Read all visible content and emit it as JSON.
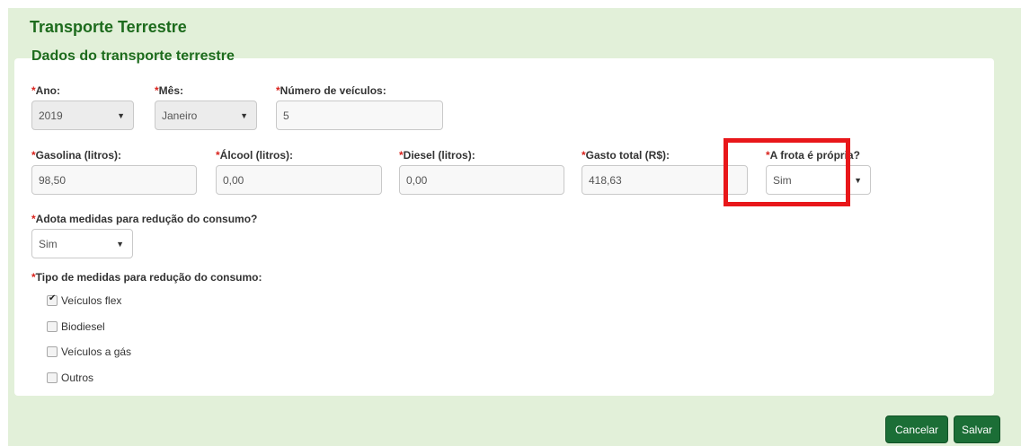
{
  "page": {
    "title": "Transporte Terrestre"
  },
  "section": {
    "title": "Dados do transporte terrestre"
  },
  "required_mark": "*",
  "fields": {
    "ano": {
      "label": "Ano:",
      "value": "2019"
    },
    "mes": {
      "label": "Mês:",
      "value": "Janeiro"
    },
    "num_veiculos": {
      "label": "Número de veículos:",
      "value": "5"
    },
    "gasolina": {
      "label": "Gasolina (litros):",
      "value": "98,50"
    },
    "alcool": {
      "label": "Álcool (litros):",
      "value": "0,00"
    },
    "diesel": {
      "label": "Diesel (litros):",
      "value": "0,00"
    },
    "gasto_total": {
      "label": "Gasto total (R$):",
      "value": "418,63"
    },
    "frota_propria": {
      "label": "A frota é própria?",
      "value": "Sim"
    },
    "adota_medidas": {
      "label": "Adota medidas para redução do consumo?",
      "value": "Sim"
    }
  },
  "tipo_medidas": {
    "label": "Tipo de medidas para redução do consumo:",
    "options": [
      {
        "label": "Veículos flex",
        "checked": true
      },
      {
        "label": "Biodiesel",
        "checked": false
      },
      {
        "label": "Veículos a gás",
        "checked": false
      },
      {
        "label": "Outros",
        "checked": false
      }
    ]
  },
  "buttons": {
    "cancel": "Cancelar",
    "save": "Salvar"
  },
  "colors": {
    "accent": "#1d6b1d",
    "button": "#1b6e36",
    "background": "#e2f0d9",
    "required": "#d9231d",
    "highlight": "#e8171a"
  },
  "icons": {
    "caret": "caret-down-icon",
    "check": "checkmark-icon"
  }
}
